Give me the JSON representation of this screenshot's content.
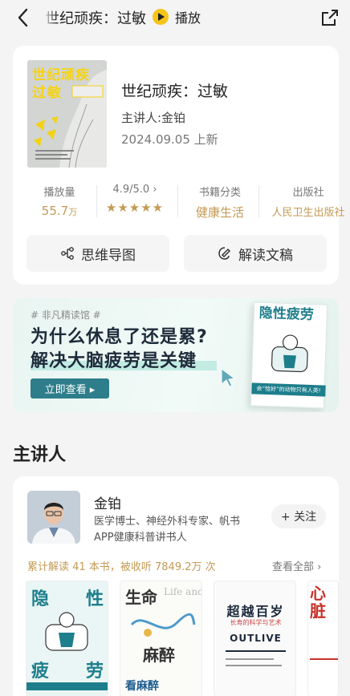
{
  "nav": {
    "title": "世纪顽疾：过敏",
    "play_label": "播放"
  },
  "book": {
    "cover_title_line1": "世纪顽疾",
    "cover_title_line2": "过敏",
    "title": "世纪顽疾：过敏",
    "speaker": "主讲人:金铂",
    "date": "2024.09.05 上新",
    "stats": [
      {
        "label": "播放量",
        "value": "55.7",
        "unit": "万"
      },
      {
        "label": "4.9/5.0",
        "value": "★★★★★"
      },
      {
        "label": "书籍分类",
        "value": "健康生活"
      },
      {
        "label": "出版社",
        "value": "人民卫生出版社"
      }
    ],
    "actions": [
      {
        "label": "思维导图",
        "icon": "mindmap-icon"
      },
      {
        "label": "解读文稿",
        "icon": "manuscript-icon"
      }
    ]
  },
  "banner": {
    "tag": "# 非凡精读馆 #",
    "line1": "为什么休息了还是累?",
    "line2": "解决大脑疲劳是关键",
    "cta": "立即查看 ▸",
    "book_title": "隐性疲劳",
    "book_band": "会“恰好”的动物只有人类!"
  },
  "speaker_section": {
    "heading": "主讲人",
    "name": "金铂",
    "desc": "医学博士、神经外科专家、帆书APP健康科普讲书人",
    "follow": "+ 关注",
    "stats_prefix": "累计解读",
    "books_count": "41",
    "books_unit": "本书，被收听",
    "listens": "7849.2万",
    "listens_unit": "次",
    "view_all": "查看全部 ›",
    "books": [
      {
        "title_a": "隐",
        "title_b": "性",
        "title_c": "疲",
        "title_d": "劳"
      },
      {
        "title_a": "生命",
        "title_b": "麻醉",
        "sub": "看麻醉",
        "en": "Life and"
      },
      {
        "title_a": "超越百岁",
        "sub": "长寿的科学与艺术",
        "en": "OUTLIVE"
      },
      {
        "title_a": "心脏"
      }
    ]
  },
  "colors": {
    "accent_gold": "#c49a55",
    "play_yellow": "#f5c518",
    "banner_teal": "#2d7e8a"
  }
}
